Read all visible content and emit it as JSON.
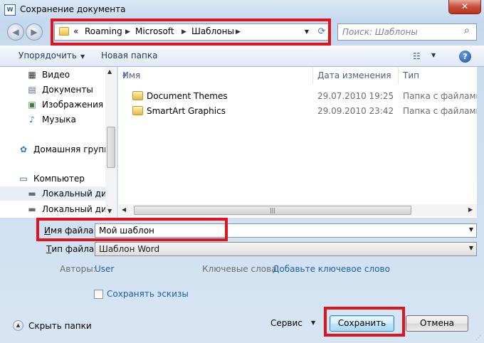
{
  "window": {
    "title": "Сохранение документа",
    "app_icon_letter": "W",
    "close_glyph": "✕"
  },
  "address": {
    "overflow": "«",
    "crumbs": [
      "Roaming",
      "Microsoft",
      "Шаблоны"
    ],
    "separator": "▶"
  },
  "search": {
    "placeholder": "Поиск: Шаблоны"
  },
  "toolbar": {
    "organize": "Упорядочить",
    "new_folder": "Новая папка"
  },
  "nav": {
    "items": [
      {
        "label": "Видео",
        "icon": "video-icon",
        "glyph": "▦"
      },
      {
        "label": "Документы",
        "icon": "documents-icon",
        "glyph": "▤"
      },
      {
        "label": "Изображения",
        "icon": "images-icon",
        "glyph": "▣"
      },
      {
        "label": "Музыка",
        "icon": "music-icon",
        "glyph": "♪"
      },
      {
        "label": "Домашняя группа",
        "icon": "homegroup-icon",
        "glyph": "✿"
      },
      {
        "label": "Компьютер",
        "icon": "computer-icon",
        "glyph": "▭"
      },
      {
        "label": "Локальный диск",
        "icon": "local-disk-icon",
        "glyph": "▬"
      },
      {
        "label": "Локальный диск",
        "icon": "local-disk-icon",
        "glyph": "▬"
      }
    ]
  },
  "filelist": {
    "columns": [
      "Имя",
      "Дата изменения",
      "Тип"
    ],
    "rows": [
      {
        "name": "Document Themes",
        "date": "29.07.2010 19:25",
        "type": "Папка с файлами"
      },
      {
        "name": "SmartArt Graphics",
        "date": "29.09.2010 23:42",
        "type": "Папка с файлами"
      }
    ]
  },
  "form": {
    "filename_label_u": "И",
    "filename_label_rest": "мя файла:",
    "filename_value": "Мой шаблон",
    "filetype_label_u": "Т",
    "filetype_label_rest": "ип файла:",
    "filetype_value": "Шаблон Word",
    "authors_label": "Авторы:",
    "authors_value": "User",
    "keywords_label": "Ключевые слова:",
    "keywords_value": "Добавьте ключевое слово",
    "thumbnails_label": "Сохранять эскизы",
    "thumbnails_checked": false
  },
  "footer": {
    "hide_folders": "Скрыть папки",
    "service": "Сервис",
    "save": "Сохранить",
    "cancel": "Отмена"
  },
  "colors": {
    "highlight": "#e0141e",
    "link": "#1e5fae"
  }
}
